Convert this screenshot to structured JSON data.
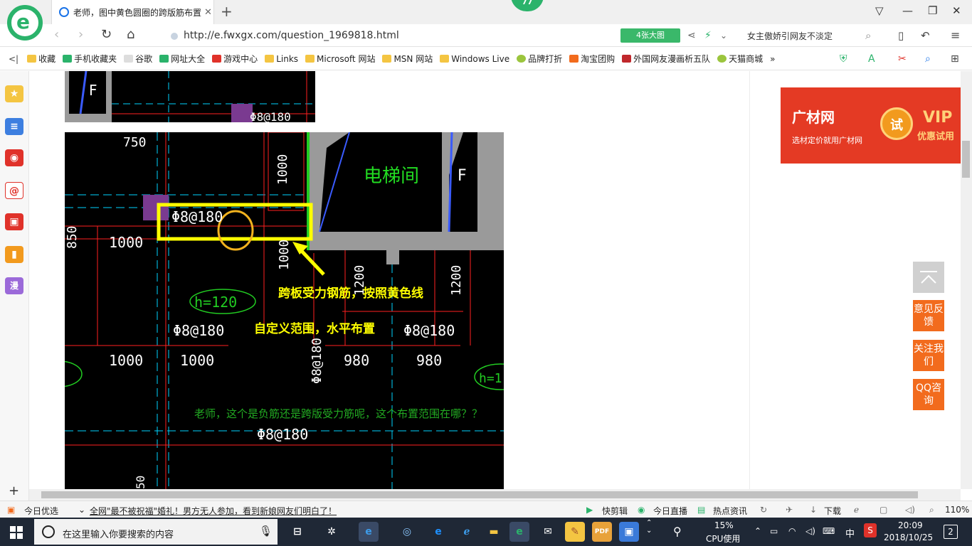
{
  "tabbar": {
    "tab_title": "老师，图中黄色圆圈的跨版筋布置",
    "close": "✕",
    "new_tab": "+",
    "badge_count": "77"
  },
  "navbar": {
    "url": "http://e.fwxgx.com/question_1969818.html",
    "big_pic_label": "4张大图",
    "search_text": "女主傲娇引网友不淡定"
  },
  "bookmarks": [
    {
      "label": "收藏",
      "color": "#f4c542"
    },
    {
      "label": "手机收藏夹",
      "color": "#2bb36b"
    },
    {
      "label": "谷歌",
      "color": "#ccc"
    },
    {
      "label": "网址大全",
      "color": "#2bb36b"
    },
    {
      "label": "游戏中心",
      "color": "#e0322a"
    },
    {
      "label": "Links",
      "color": "#f4c542"
    },
    {
      "label": "Microsoft 网站",
      "color": "#f4c542"
    },
    {
      "label": "MSN 网站",
      "color": "#f4c542"
    },
    {
      "label": "Windows Live",
      "color": "#f4c542"
    },
    {
      "label": "品牌打折",
      "color": "#9bc53d"
    },
    {
      "label": "淘宝团购",
      "color": "#f26b1d"
    },
    {
      "label": "外国网友漫画析五队",
      "color": "#c0282c"
    },
    {
      "label": "天猫商城",
      "color": "#9bc53d"
    }
  ],
  "bookmarks_more": "»",
  "cad": {
    "top_label": "Φ8@180",
    "elevator_room": "电梯间",
    "elevator_f": "F",
    "rebar_main": "Φ8@180",
    "dim_750": "750",
    "dim_1000_v": "1000",
    "dim_850": "850",
    "dim_1000_a": "1000",
    "dim_1000_b": "1000",
    "dim_1000_c": "1000",
    "dim_980_a": "980",
    "dim_980_b": "980",
    "dim_1200_a": "1200",
    "dim_1200_b": "1200",
    "h120": "h=120",
    "h1": "h=1",
    "rebar_mid_left": "Φ8@180",
    "rebar_mid_right": "Φ8@180",
    "rebar_vertical": "Φ8@180",
    "rebar_bottom": "Φ8@180",
    "annotation_line1": "跨板受力钢筋，按照黄色线",
    "annotation_line2": "自定义范围，水平布置",
    "question": "老师，这个是负筋还是跨版受力筋呢，这个布置范围在哪？？",
    "dim_50": "50"
  },
  "ad": {
    "brand": "广材网",
    "slogan": "选材定价就用广材网",
    "try": "试",
    "vip": "VIP",
    "vip_sub": "优惠试用"
  },
  "float_buttons": {
    "feedback": "意见反馈",
    "follow": "关注我们",
    "qq": "QQ咨询"
  },
  "statusbar": {
    "today": "今日优选",
    "news": "全网\"最不被祝福\"婚礼！男方无人参加，看到新娘网友们明白了！",
    "quick_edit": "快剪辑",
    "live": "今日直播",
    "hot_news": "热点资讯",
    "download": "下载",
    "zoom": "110%"
  },
  "taskbar": {
    "search_placeholder": "在这里输入你要搜索的内容",
    "cpu_percent": "15%",
    "cpu_label": "CPU使用",
    "ime": "中",
    "time": "20:09",
    "date": "2018/10/25",
    "notifications": "2"
  }
}
